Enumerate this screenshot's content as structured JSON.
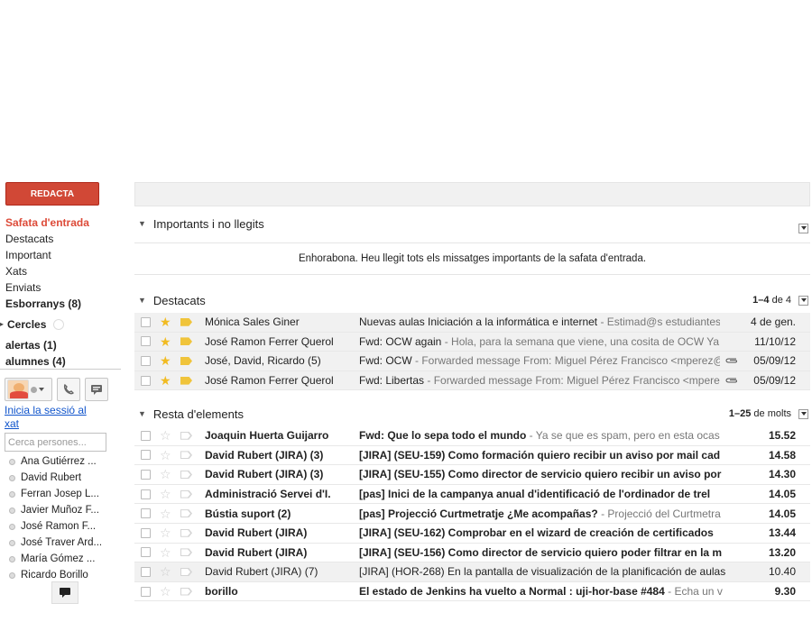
{
  "compose_label": "REDACTA",
  "nav": {
    "inbox": "Safata d'entrada",
    "starred": "Destacats",
    "important": "Important",
    "chats": "Xats",
    "sent": "Enviats",
    "drafts": "Esborranys (8)"
  },
  "circles_label": "Cercles",
  "labels": [
    "alertas (1)",
    "alumnes (4)"
  ],
  "chat": {
    "signin_link": "Inicia la sessió al xat",
    "search_placeholder": "Cerca persones...",
    "contacts": [
      "Ana Gutiérrez ...",
      "David Rubert",
      "Ferran Josep L...",
      "Javier Muñoz F...",
      "José Ramon F...",
      "José Traver Ard...",
      "María Gómez ...",
      "Ricardo Borillo"
    ]
  },
  "sections": {
    "important": {
      "title": "Importants i no llegits",
      "empty_message": "Enhorabona. Heu llegit tots els missatges importants de la safata d'entrada."
    },
    "starred": {
      "title": "Destacats",
      "count_range": "1–4",
      "count_of": "de 4"
    },
    "rest": {
      "title": "Resta d'elements",
      "count_range": "1–25",
      "count_of": "de molts"
    }
  },
  "starred_rows": [
    {
      "sender": "Mónica Sales Giner",
      "subject": "Nuevas aulas Iniciación a la informática e internet",
      "snippet": " - Estimad@s estudiantes,",
      "date": "4 de gen.",
      "attachment": false
    },
    {
      "sender": "José Ramon Ferrer Querol",
      "subject": "Fwd: OCW again",
      "snippet": " - Hola, para la semana que viene, una cosita de OCW Ya",
      "date": "11/10/12",
      "attachment": false
    },
    {
      "sender": "José, David, Ricardo (5)",
      "subject": "Fwd: OCW",
      "snippet": " -  Forwarded message From: Miguel Pérez Francisco <mperez@",
      "date": "05/09/12",
      "attachment": true
    },
    {
      "sender": "José Ramon Ferrer Querol",
      "subject": "Fwd: Libertas",
      "snippet": " -  Forwarded message From: Miguel Pérez Francisco <mpere.",
      "date": "05/09/12",
      "attachment": true
    }
  ],
  "rest_rows": [
    {
      "sender": "Joaquin Huerta Guijarro",
      "subject": "Fwd: Que lo sepa todo el mundo",
      "snippet": " - Ya se que es spam, pero en esta ocas",
      "date": "15.52",
      "unread": true
    },
    {
      "sender": "David Rubert (JIRA) (3)",
      "subject": "[JIRA] (SEU-159) Como formación quiero recibir un aviso por mail cad",
      "snippet": "",
      "date": "14.58",
      "unread": true
    },
    {
      "sender": "David Rubert (JIRA) (3)",
      "subject": "[JIRA] (SEU-155) Como director de servicio quiero recibir un aviso por",
      "snippet": "",
      "date": "14.30",
      "unread": true
    },
    {
      "sender": "Administració Servei d'I.",
      "subject": "[pas] Inici de la campanya anual d'identificació de l'ordinador de trel",
      "snippet": "",
      "date": "14.05",
      "unread": true
    },
    {
      "sender": "Bústia suport (2)",
      "subject": "[pas] Projecció Curtmetratje ¿Me acompañas?",
      "snippet": " - Projecció del Curtmetra",
      "date": "14.05",
      "unread": true
    },
    {
      "sender": "David Rubert (JIRA)",
      "subject": "[JIRA] (SEU-162) Comprobar en el wizard de creación de certificados",
      "snippet": "",
      "date": "13.44",
      "unread": true
    },
    {
      "sender": "David Rubert (JIRA)",
      "subject": "[JIRA] (SEU-156) Como director de servicio quiero poder filtrar en la m",
      "snippet": "",
      "date": "13.20",
      "unread": true
    },
    {
      "sender": "David Rubert (JIRA) (7)",
      "subject": "[JIRA] (HOR-268) En la pantalla de visualización de la planificación de aulas",
      "snippet": "",
      "date": "10.40",
      "unread": false
    },
    {
      "sender": "borillo",
      "subject": "El estado de Jenkins ha vuelto a Normal : uji-hor-base #484",
      "snippet": " - Echa un v",
      "date": "9.30",
      "unread": true
    }
  ],
  "colors": {
    "compose": "#d14836",
    "inbox_active": "#dd4b39",
    "star_on": "#f1bb22",
    "important_on": "#f0c43b",
    "link": "#1155cc"
  },
  "icons": {
    "star": "star-icon",
    "important": "important-marker-icon",
    "attachment": "paperclip-icon",
    "phone": "phone-icon",
    "video": "video-chat-icon",
    "chat": "chat-bubble-icon"
  }
}
